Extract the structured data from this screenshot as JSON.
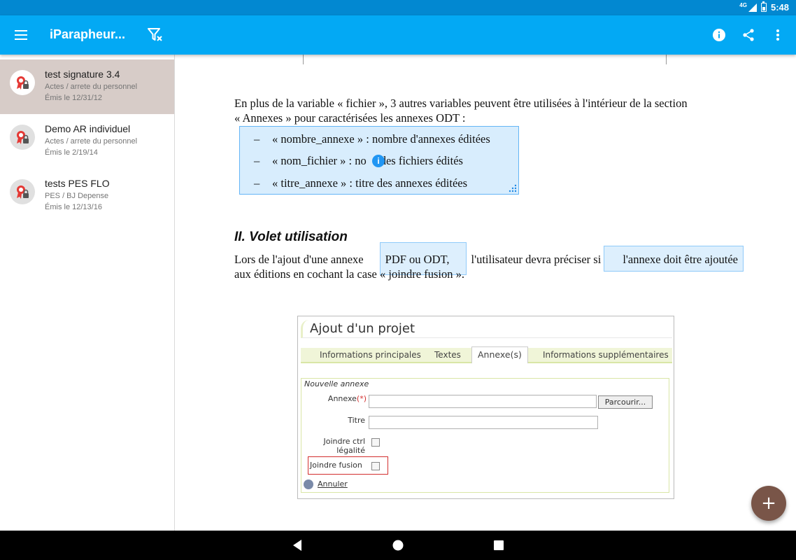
{
  "status": {
    "network": "4G",
    "time": "5:48"
  },
  "appbar": {
    "title": "iParapheur...",
    "menu_icon": "hamburger-menu-icon",
    "filter_icon": "filter-clear-icon",
    "actions": [
      "info-icon",
      "share-icon",
      "more-vert-icon"
    ]
  },
  "colors": {
    "statusbar": "#0288D1",
    "appbar": "#03A9F4",
    "selected_item": "#D7CCC8",
    "fab": "#795548",
    "highlight": "#90CAF9"
  },
  "sidebar": {
    "items": [
      {
        "name": "test signature 3.4",
        "sub": "Actes / arrete du personnel",
        "date": "Émis le 12/31/12",
        "selected": true
      },
      {
        "name": "Demo AR individuel",
        "sub": "Actes / arrete du personnel",
        "date": "Émis le 2/19/14",
        "selected": false
      },
      {
        "name": "tests PES FLO",
        "sub": "PES / BJ Depense",
        "date": "Émis le 12/13/16",
        "selected": false
      }
    ]
  },
  "document": {
    "para1_line1": "En plus de la variable « fichier », 3 autres variables peuvent être utilisées à l'intérieur de la section",
    "para1_line2": "« Annexes » pour caractérisées les annexes ODT :",
    "bullet_dash": "–",
    "bullets": [
      "« nombre_annexe » : nombre d'annexes éditées",
      "« nom_fichier » : no",
      "des fichiers édités",
      "« titre_annexe » : titre des annexes éditées"
    ],
    "info_badge": "i",
    "heading": "II.  Volet utilisation",
    "para2_line1_a": "Lors de l'ajout d'une annexe",
    "para2_line1_b": "PDF ou ODT,",
    "para2_line1_c": "l'utilisateur devra préciser si",
    "para2_line1_d": "l'annexe doit être ajoutée",
    "para2_line2": "aux éditions en cochant la case « joindre fusion ».",
    "screenshot": {
      "title": "Ajout d'un projet",
      "tabs": [
        "Informations principales",
        "Textes",
        "Annexe(s)",
        "Informations supplémentaires"
      ],
      "active_tab": "Annexe(s)",
      "legend": "Nouvelle annexe",
      "annexe_label": "Annexe",
      "required_mark": "(*)",
      "browse_button": "Parcourir...",
      "titre_label": "Titre",
      "joindre_ctrl_line1": "Joindre ctrl",
      "joindre_ctrl_line2": "légalité",
      "joindre_fusion_label": "Joindre fusion",
      "cancel_link": "Annuler"
    }
  },
  "fab": {
    "label": "+"
  }
}
